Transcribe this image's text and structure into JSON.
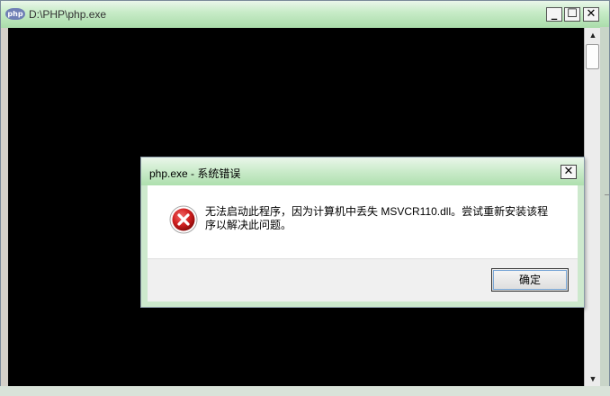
{
  "window": {
    "icon_text": "php",
    "title": "D:\\PHP\\php.exe",
    "min_glyph": "_",
    "max_glyph": "☐",
    "close_glyph": "✕"
  },
  "scrollbar": {
    "up_glyph": "▲",
    "down_glyph": "▼"
  },
  "dialog": {
    "title": "php.exe - 系统错误",
    "close_glyph": "✕",
    "icon": "error-icon",
    "message": "无法启动此程序，因为计算机中丢失 MSVCR110.dll。尝试重新安装该程序以解决此问题。",
    "ok_label": "确定"
  },
  "colors": {
    "titlebar": "#b6e2b6",
    "console_bg": "#000000",
    "error_red": "#d01f1f"
  }
}
